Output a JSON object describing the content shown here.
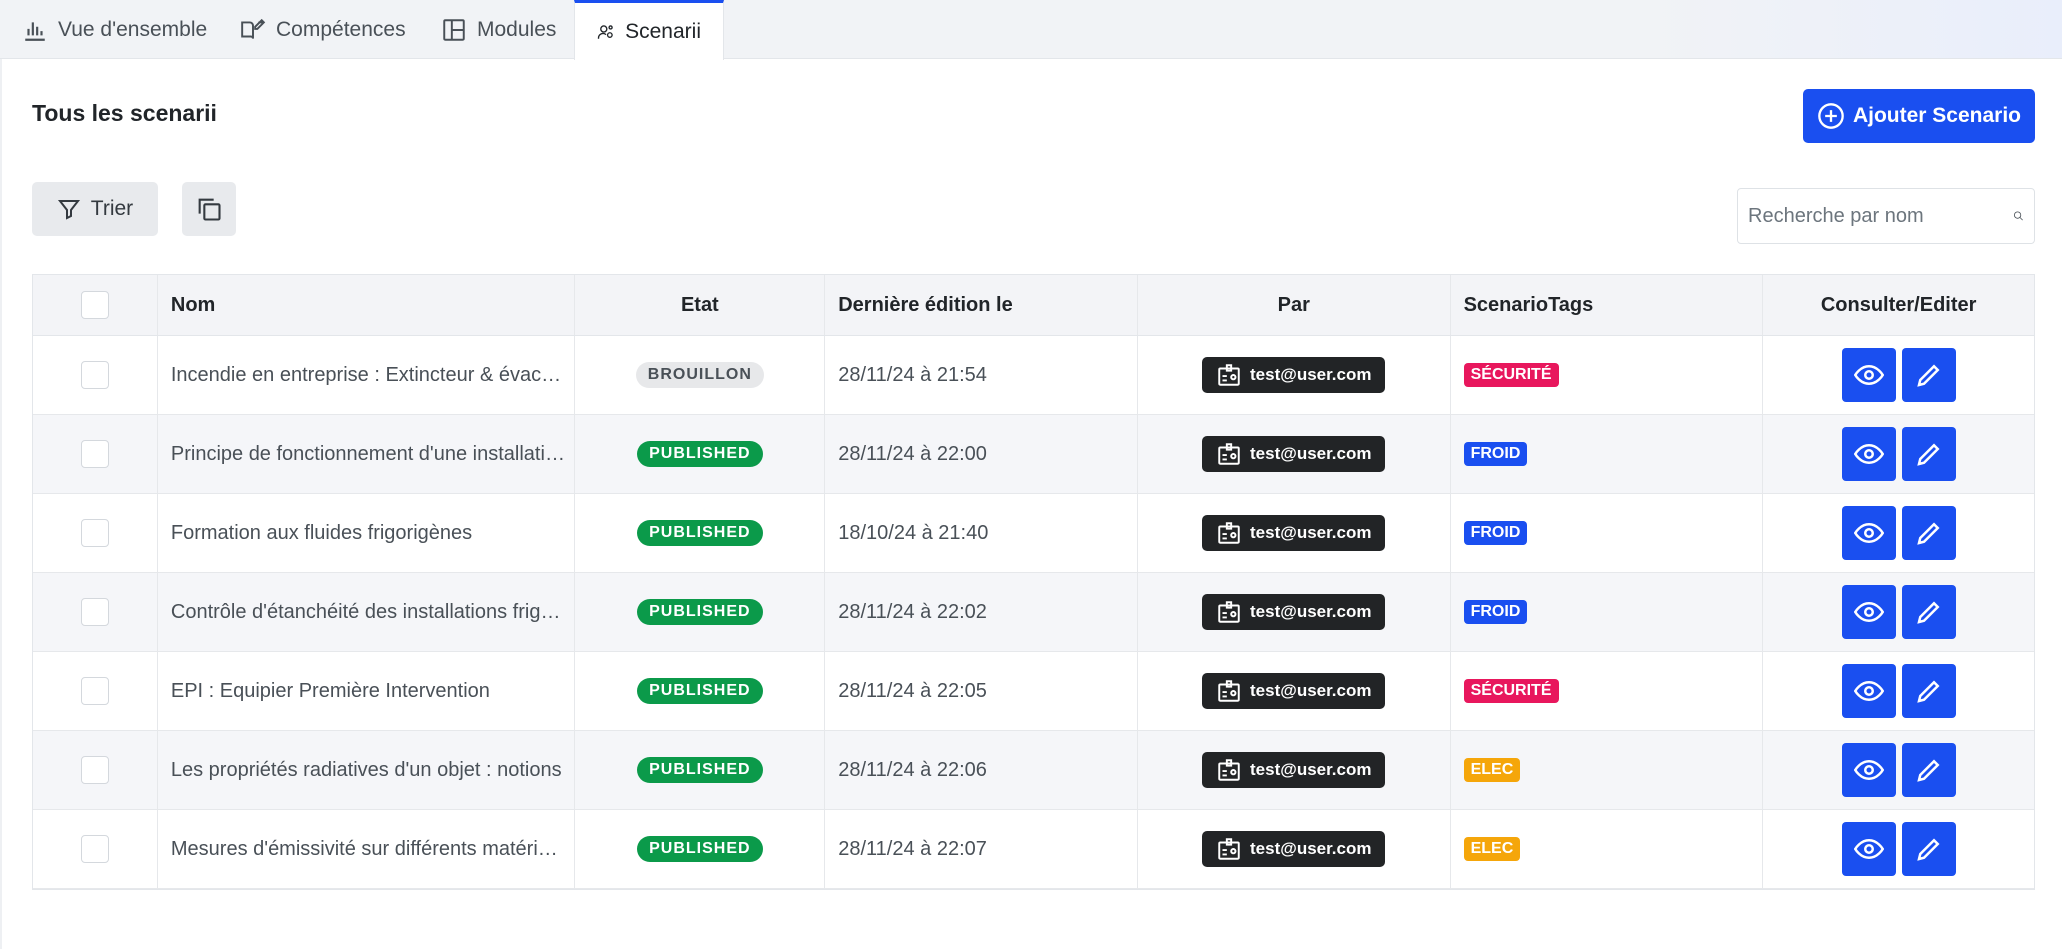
{
  "tabs": [
    {
      "label": "Vue d'ensemble",
      "icon": "bar-chart-icon"
    },
    {
      "label": "Compétences",
      "icon": "book-edit-icon"
    },
    {
      "label": "Modules",
      "icon": "layout-icon"
    },
    {
      "label": "Scenarii",
      "icon": "users-settings-icon"
    }
  ],
  "page": {
    "title": "Tous les scenarii",
    "add_button": "Ajouter Scenario",
    "sort_button": "Trier",
    "search_placeholder": "Recherche par nom"
  },
  "table": {
    "headers": {
      "name": "Nom",
      "state": "Etat",
      "date": "Dernière édition le",
      "by": "Par",
      "tags": "ScenarioTags",
      "actions": "Consulter/Editer"
    },
    "rows": [
      {
        "name": "Incendie en entreprise : Extincteur & évacuation",
        "state": "BROUILLON",
        "date": "28/11/24 à 21:54",
        "by": "test@user.com",
        "tag": "SÉCURITÉ"
      },
      {
        "name": "Principe de fonctionnement d'une installation frigorifique",
        "state": "PUBLISHED",
        "date": "28/11/24 à 22:00",
        "by": "test@user.com",
        "tag": "FROID"
      },
      {
        "name": "Formation aux fluides frigorigènes",
        "state": "PUBLISHED",
        "date": "18/10/24 à 21:40",
        "by": "test@user.com",
        "tag": "FROID"
      },
      {
        "name": "Contrôle d'étanchéité des installations frigorifiques",
        "state": "PUBLISHED",
        "date": "28/11/24 à 22:02",
        "by": "test@user.com",
        "tag": "FROID"
      },
      {
        "name": "EPI : Equipier Première Intervention",
        "state": "PUBLISHED",
        "date": "28/11/24 à 22:05",
        "by": "test@user.com",
        "tag": "SÉCURITÉ"
      },
      {
        "name": "Les propriétés radiatives d'un objet : notions",
        "state": "PUBLISHED",
        "date": "28/11/24 à 22:06",
        "by": "test@user.com",
        "tag": "ELEC"
      },
      {
        "name": "Mesures d'émissivité sur différents matériaux",
        "state": "PUBLISHED",
        "date": "28/11/24 à 22:07",
        "by": "test@user.com",
        "tag": "ELEC"
      }
    ]
  },
  "colors": {
    "primary": "#1a4ff0",
    "published": "#0b9a4a",
    "draft": "#e7e8ea",
    "tag_securite": "#e8175d",
    "tag_froid": "#1a4ff0",
    "tag_elec": "#f5a60a"
  }
}
